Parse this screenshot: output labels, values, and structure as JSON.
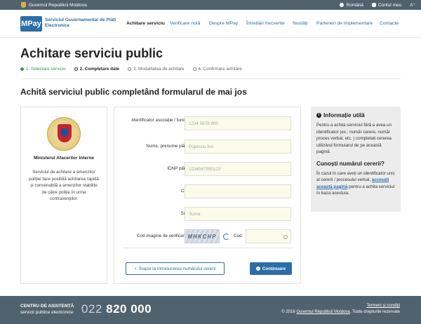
{
  "topbar": {
    "gov_name": "Guvernul Republicii Moldova",
    "language": "Română",
    "account": "Contul meu",
    "font_size": "A⁺"
  },
  "header": {
    "logo": "MPay",
    "logo_text": "Serviciul Guvernamental de Plăți Electronice",
    "nav": [
      "Achitare serviciu",
      "Verificare notă",
      "Despre MPay",
      "Întrebări frecvente",
      "Noutăți",
      "Parteneri de implementare",
      "Contacte"
    ],
    "active_nav": "Achitare serviciu"
  },
  "page": {
    "title": "Achitare serviciu public",
    "steps": [
      {
        "label": "1. Selectare serviciu",
        "state": "done"
      },
      {
        "label": "2. Completare date",
        "state": "current"
      },
      {
        "label": "3. Modalitatea de achitare",
        "state": "todo"
      },
      {
        "label": "4. Confirmare achitare",
        "state": "todo"
      }
    ],
    "section_title": "Achită serviciul public completând formularul de mai jos"
  },
  "org": {
    "name": "Ministerul Afacerilor Interne",
    "description": "Serviciul de achitare a amenzilor poliției face posibilă achitarea rapidă și convenabilă a amenzilor stabilite de către poliție în urma contravențiilor."
  },
  "form": {
    "fields": [
      {
        "label": "Identificator asociație / fundație",
        "placeholder": "1234 5678 900"
      },
      {
        "label": "Nume, prenume plătitor",
        "placeholder": "Popescu Ion"
      },
      {
        "label": "IDNP plătitor",
        "placeholder": "1234567890123"
      },
      {
        "label": "Clasa",
        "placeholder": ""
      },
      {
        "label": "Suma",
        "placeholder": "Suma"
      }
    ],
    "captcha_label": "Cod imagine de verificare:",
    "captcha_text": "MHKCHP",
    "code_label": "Cod:",
    "back_button": "Înapoi la introducerea numărului cererii",
    "next_button": "Continuare"
  },
  "info": {
    "title": "Informație utilă",
    "text": "Pentru a achita serviciul fără a avea un identificator (ex.: număr cerere, număr proces verbal, etc. ) completați cererea utilizând formularul de pe această pagină.",
    "question": "Cunoști numărul cererii?",
    "text2_a": "În cazul în care aveți un identificator unic al cererii / procesului verbal,",
    "link": "accesați această pagină",
    "text2_b": "pentru a achita serviciul în baza acestuia."
  },
  "footer": {
    "center_line1": "CENTRU DE ASISTENȚĂ",
    "center_line2": "servicii publice electronice",
    "phone_prefix": "022",
    "phone_number": "820 000",
    "terms": "Termeni și condiții",
    "copyright_a": "© 2016",
    "copyright_link": "Guvernul Republicii Moldova",
    "copyright_b": ". Toate drepturile rezervate"
  },
  "colors": {
    "brand": "#2d6ea6",
    "bar": "#51626f",
    "done": "#3a9a4a"
  }
}
